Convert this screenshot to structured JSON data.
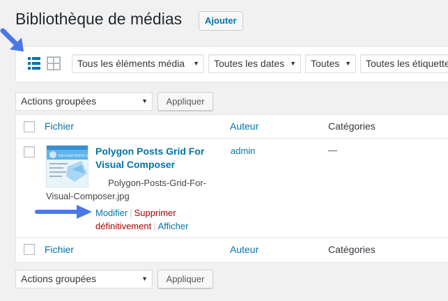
{
  "header": {
    "title": "Bibliothèque de médias",
    "add_new": "Ajouter"
  },
  "filters": {
    "media_type": "Tous les éléments média",
    "dates": "Toutes les dates",
    "all": "Toutes",
    "tags": "Toutes les étiquettes"
  },
  "bulk_top": {
    "select": "Actions groupées",
    "apply": "Appliquer"
  },
  "bulk_bottom": {
    "select": "Actions groupées",
    "apply": "Appliquer"
  },
  "columns": {
    "file": "Fichier",
    "author": "Auteur",
    "categories": "Catégories"
  },
  "row": {
    "thumb_banner": "POLYGON POSTS G",
    "title_line1": "Polygon Posts Grid For",
    "title_line2": "Visual Composer",
    "filename_line1": "Polygon-Posts-Grid-For-",
    "filename_line2": "Visual-Composer.jpg",
    "author": "admin",
    "categories": "—",
    "actions": {
      "edit": "Modifier",
      "delete_line1": "Supprimer",
      "delete_line2": "définitivement",
      "view": "Afficher"
    }
  },
  "colors": {
    "link": "#0073aa",
    "delete": "#a00000",
    "annotation_arrow": "#4a78e6"
  },
  "icons": {
    "list_view": "list-view-icon",
    "grid_view": "grid-view-icon",
    "dropdown": "chevron-down-icon",
    "annotation": "arrow-annotation-icon"
  }
}
